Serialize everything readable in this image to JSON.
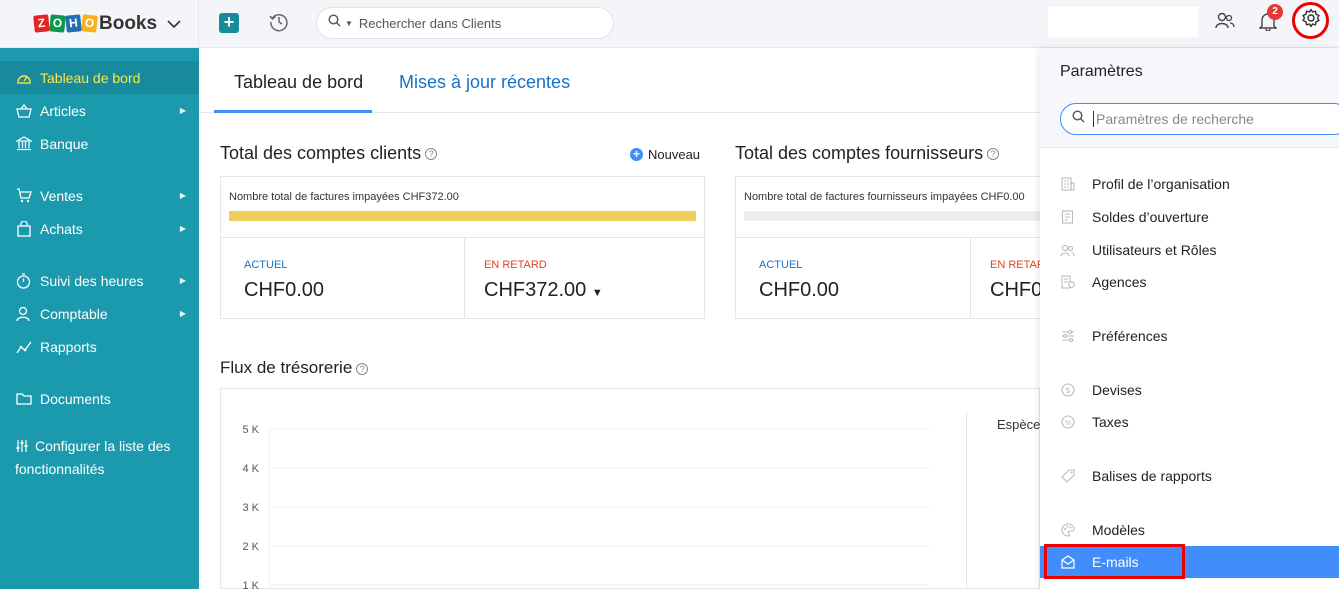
{
  "app": {
    "logo_letters": [
      "Z",
      "O",
      "H",
      "O"
    ],
    "logo_text": "Books"
  },
  "sidebar": {
    "items": [
      {
        "label": "Tableau de bord",
        "icon": "dashboard-icon",
        "active": true
      },
      {
        "label": "Articles",
        "icon": "basket-icon",
        "has_submenu": true
      },
      {
        "label": "Banque",
        "icon": "bank-icon"
      },
      {
        "label": "Ventes",
        "icon": "cart-icon",
        "has_submenu": true
      },
      {
        "label": "Achats",
        "icon": "bag-icon",
        "has_submenu": true
      },
      {
        "label": "Suivi des heures",
        "icon": "stopwatch-icon",
        "has_submenu": true
      },
      {
        "label": "Comptable",
        "icon": "accountant-icon",
        "has_submenu": true
      },
      {
        "label": "Rapports",
        "icon": "reports-icon"
      },
      {
        "label": "Documents",
        "icon": "folder-icon"
      }
    ],
    "config_label": "Configurer la liste des fonctionnalités"
  },
  "topbar": {
    "search_placeholder": "Rechercher dans Clients",
    "notification_count": "2"
  },
  "main": {
    "tabs": [
      {
        "label": "Tableau de bord",
        "active": true
      },
      {
        "label": "Mises à jour récentes"
      }
    ],
    "receivables": {
      "title": "Total des comptes clients",
      "new_label": "Nouveau",
      "unpaid_label": "Nombre total de factures impayées CHF372.00",
      "progress": 1.0,
      "current_label": "ACTUEL",
      "current_value": "CHF0.00",
      "overdue_label": "EN RETARD",
      "overdue_value": "CHF372.00"
    },
    "payables": {
      "title": "Total des comptes fournisseurs",
      "unpaid_label": "Nombre total de factures fournisseurs impayées CHF0.00",
      "progress": 0.0,
      "current_label": "ACTUEL",
      "current_value": "CHF0.00",
      "overdue_label": "EN RETARD",
      "overdue_value": "CHF0"
    },
    "cashflow": {
      "title": "Flux de trésorerie",
      "legend_label": "Espèce"
    }
  },
  "chart_data": {
    "type": "line",
    "title": "Flux de trésorerie",
    "y_ticks": [
      "5 K",
      "4 K",
      "3 K",
      "2 K",
      "1 K"
    ],
    "ylim": [
      1000,
      5000
    ],
    "series": []
  },
  "settings_panel": {
    "title": "Paramètres",
    "search_placeholder": "Paramètres de recherche",
    "items": [
      {
        "label": "Profil de l’organisation",
        "icon": "building-icon"
      },
      {
        "label": "Soldes d’ouverture",
        "icon": "ledger-icon"
      },
      {
        "label": "Utilisateurs et Rôles",
        "icon": "users-icon"
      },
      {
        "label": "Agences",
        "icon": "branch-icon"
      },
      {
        "label": "Préférences",
        "icon": "sliders-icon"
      },
      {
        "label": "Devises",
        "icon": "currency-icon"
      },
      {
        "label": "Taxes",
        "icon": "percent-icon"
      },
      {
        "label": "Balises de rapports",
        "icon": "tag-icon"
      },
      {
        "label": "Modèles",
        "icon": "palette-icon"
      },
      {
        "label": "E-mails",
        "icon": "mail-icon",
        "selected": true
      }
    ]
  },
  "colors": {
    "sidebar": "#1b9aad",
    "active_text": "#fbe64c",
    "accent": "#408dfb",
    "progress_fill": "#f0ce5b",
    "overdue": "#e0431a",
    "highlight_frame": "#e00000"
  }
}
